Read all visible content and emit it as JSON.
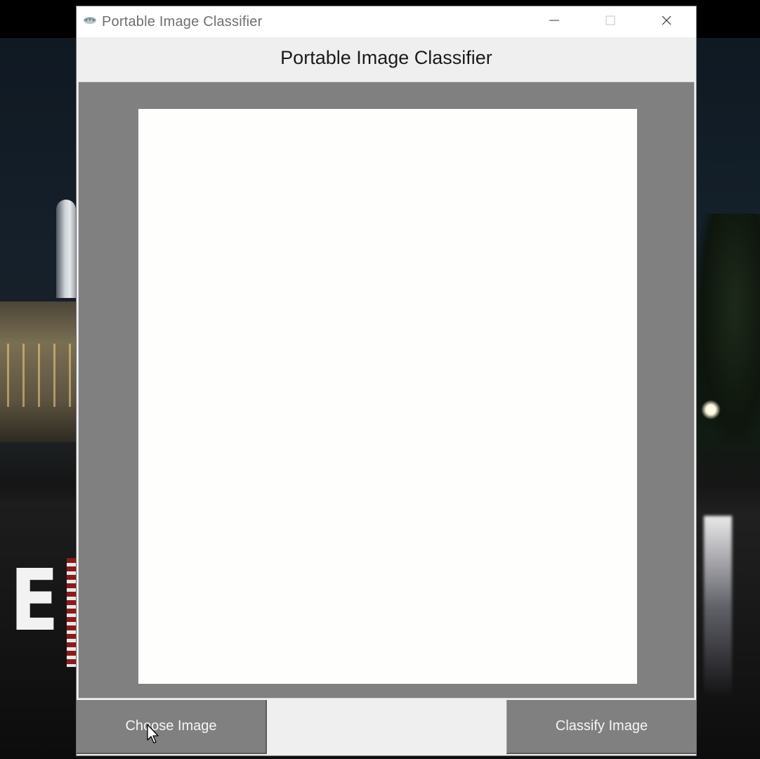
{
  "window": {
    "title": "Portable Image Classifier",
    "app_icon": "feather-icon",
    "controls": {
      "minimize_icon": "minimize-icon",
      "maximize_icon": "maximize-icon",
      "close_icon": "close-icon"
    }
  },
  "header": {
    "title": "Portable Image Classifier"
  },
  "preview": {
    "frame_color": "#808080",
    "canvas_color": "#fefefc"
  },
  "actions": {
    "choose_label": "Choose Image",
    "classify_label": "Classify Image",
    "button_color": "#808080"
  },
  "desktop": {
    "wallpaper_text": "E"
  }
}
